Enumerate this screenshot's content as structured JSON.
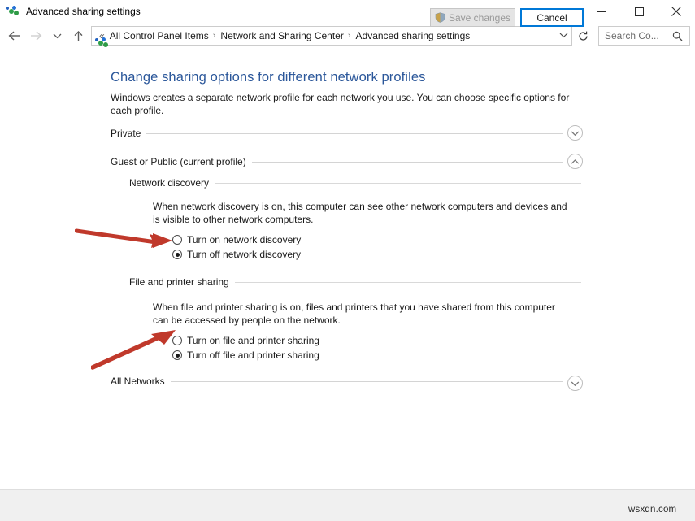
{
  "window": {
    "title": "Advanced sharing settings",
    "icon": "network-sharing-icon",
    "minimize_label": "–",
    "maximize_label": "□",
    "close_label": "✕"
  },
  "nav": {
    "back_label": "←",
    "forward_label": "→",
    "recent_label": "˅",
    "up_label": "↑",
    "refresh_label": "↻",
    "dropdown_label": "˅",
    "breadcrumb_prefix": "«",
    "breadcrumb": [
      "All Control Panel Items",
      "Network and Sharing Center",
      "Advanced sharing settings"
    ],
    "breadcrumb_separator": "›",
    "search_placeholder": "Search Co...",
    "search_value": ""
  },
  "main": {
    "heading": "Change sharing options for different network profiles",
    "description": "Windows creates a separate network profile for each network you use. You can choose specific options for each profile.",
    "profiles": [
      {
        "name": "Private",
        "expanded": false,
        "toggle_glyph": "chevron-down-icon"
      },
      {
        "name": "Guest or Public (current profile)",
        "expanded": true,
        "toggle_glyph": "chevron-up-icon"
      }
    ],
    "sections": [
      {
        "title": "Network discovery",
        "description": "When network discovery is on, this computer can see other network computers and devices and is visible to other network computers.",
        "options": [
          {
            "label": "Turn on network discovery",
            "selected": false
          },
          {
            "label": "Turn off network discovery",
            "selected": true
          }
        ]
      },
      {
        "title": "File and printer sharing",
        "description": "When file and printer sharing is on, files and printers that you have shared from this computer can be accessed by people on the network.",
        "options": [
          {
            "label": "Turn on file and printer sharing",
            "selected": false
          },
          {
            "label": "Turn off file and printer sharing",
            "selected": true
          }
        ]
      }
    ],
    "all_networks": {
      "name": "All Networks",
      "expanded": false,
      "toggle_glyph": "chevron-down-icon"
    }
  },
  "footer": {
    "save_label": "Save changes",
    "save_enabled": false,
    "save_icon": "uac-shield-icon",
    "cancel_label": "Cancel",
    "cancel_focused": true
  },
  "watermark": "wsxdn.com",
  "colors": {
    "heading": "#2b579a",
    "accent": "#0078d7",
    "annotation_arrow": "#c0392b",
    "footer_bg": "#f0f0f0",
    "rule": "#d4d4d4"
  },
  "annotations": [
    {
      "name": "arrow-to-turn-on-network-discovery",
      "direction": "right"
    },
    {
      "name": "arrow-to-turn-on-file-and-printer-sharing",
      "direction": "up-right"
    }
  ]
}
